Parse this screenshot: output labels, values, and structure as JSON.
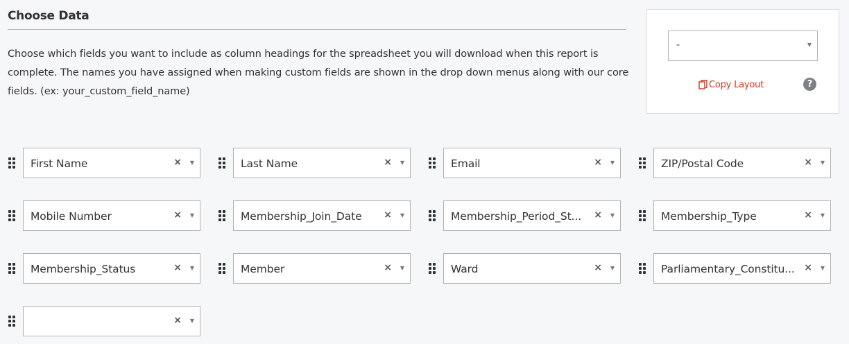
{
  "header": {
    "title": "Choose Data",
    "description": "Choose which fields you want to include as column headings for the spreadsheet you will download when this report is complete. The names you have assigned when making custom fields are shown in the drop down menus along with our core fields. (ex: your_custom_field_name)"
  },
  "layout_panel": {
    "select_value": "-",
    "copy_label": "Copy Layout",
    "help_glyph": "?"
  },
  "icons": {
    "drag_handle": "drag-handle-icon",
    "clear": "×",
    "caret": "▼"
  },
  "colors": {
    "accent": "#d0341f",
    "background": "#f6f7f9",
    "border": "#aeb1b5"
  },
  "fields": [
    {
      "value": "First Name"
    },
    {
      "value": "Last Name"
    },
    {
      "value": "Email"
    },
    {
      "value": "ZIP/Postal Code"
    },
    {
      "value": "Mobile Number"
    },
    {
      "value": "Membership_Join_Date"
    },
    {
      "value": "Membership_Period_St..."
    },
    {
      "value": "Membership_Type"
    },
    {
      "value": "Membership_Status"
    },
    {
      "value": "Member"
    },
    {
      "value": "Ward"
    },
    {
      "value": "Parliamentary_Constitu..."
    },
    {
      "value": ""
    }
  ]
}
